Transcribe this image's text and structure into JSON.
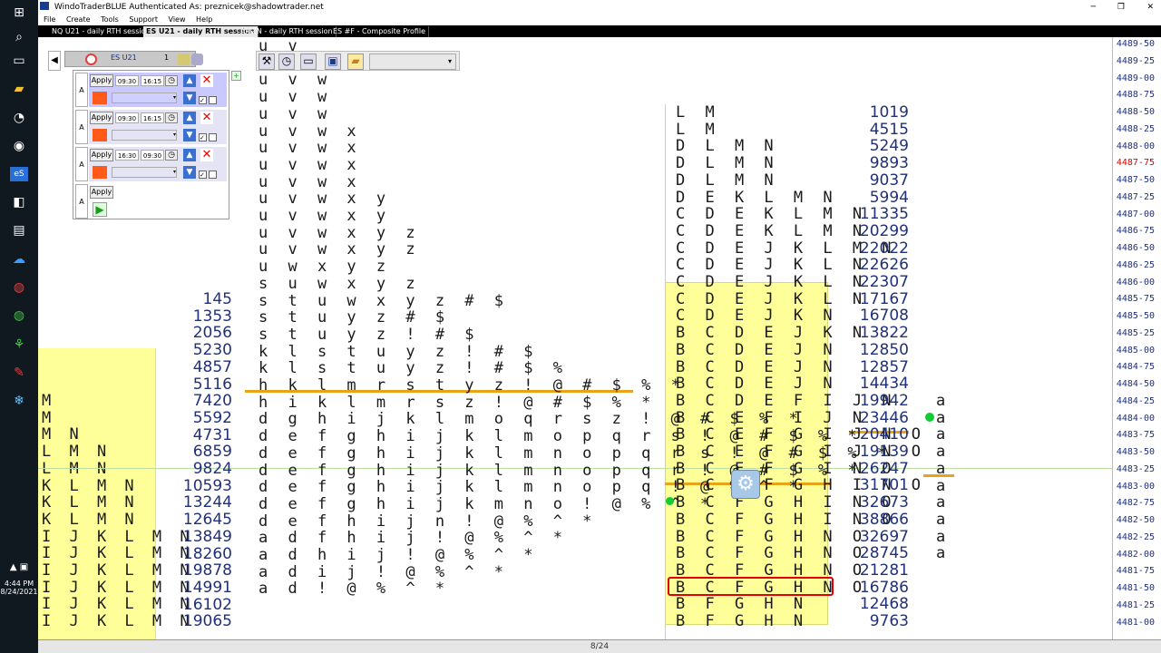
{
  "app_title": "WindoTraderBLUE  Authenticated As: preznicek@shadowtrader.net",
  "menu": [
    "File",
    "Create",
    "Tools",
    "Support",
    "View",
    "Help"
  ],
  "tabs": [
    "NQ U21 - daily RTH session",
    "ES U21 - daily RTH session",
    "AMZN - daily RTH session",
    "ES #F - Composite Profile"
  ],
  "toolbar": {
    "symbol": "ES U21",
    "count": "1"
  },
  "panel": {
    "rows": [
      {
        "side": "A",
        "apply": "Apply",
        "start": "09:30",
        "end": "16:15"
      },
      {
        "side": "A",
        "apply": "Apply",
        "start": "09:30",
        "end": "16:15"
      },
      {
        "side": "A",
        "apply": "Apply",
        "start": "16:30",
        "end": "09:30"
      },
      {
        "side": "A",
        "apply": "Apply"
      }
    ]
  },
  "tray": {
    "time": "4:44 PM",
    "date": "8/24/2021"
  },
  "status": "8/24",
  "prices": [
    "4489-50",
    "4489-25",
    "4489-00",
    "4488-75",
    "4488-50",
    "4488-25",
    "4488-00",
    "4487-75",
    "4487-50",
    "4487-25",
    "4487-00",
    "4486-75",
    "4486-50",
    "4486-25",
    "4486-00",
    "4485-75",
    "4485-50",
    "4485-25",
    "4485-00",
    "4484-75",
    "4484-50",
    "4484-25",
    "4484-00",
    "4483-75",
    "4483-50",
    "4483-25",
    "4483-00",
    "4482-75",
    "4482-50",
    "4482-25",
    "4482-00",
    "4481-75",
    "4481-50",
    "4481-25",
    "4481-00"
  ],
  "highlight_price": "4487-75",
  "overnight_profile": [
    "u v",
    "u v",
    "u v w",
    "u v w",
    "u v w",
    "u v w x",
    "u v w x",
    "u v w x",
    "u v w x",
    "u v w x y",
    "u v w x y",
    "u v w x y z",
    "u v w x y z",
    "u w x y z",
    "s u w x y z",
    "s t u w x y z # $",
    "s t u y z # $",
    "s t u y z ! # $",
    "k l s t u y z ! # $",
    "k l s t u y z ! # $ %",
    "h k l m r s t y z ! @ # $ % *",
    "h i k l m r s z ! @ # $ % *",
    "d g h i j k l m o q r s z ! @ # $ % *",
    "d e f g h i j k l m o p q r s ! @ # $ % *",
    "d e f g h i j k l m n o p q r s ! @ # $ % *",
    "d e f g h i j k l m n o p q r ! @ # $ % *",
    "d e f g h i j k l m n o p q ! @ % ^ *",
    "d e f g h i j k m n o ! @ % ^ *",
    "d e f h i j n ! @ % ^ *",
    "a d f h i j ! @ % ^ *",
    "a d h i j ! @ % ^ *",
    "a d i j ! @ % ^ *",
    "a d ! @ % ^ *"
  ],
  "overnight_volumes": [
    "145",
    "1353",
    "2056",
    "5230",
    "4857",
    "5116",
    "7420",
    "5592",
    "4731",
    "6859",
    "9824",
    "10593",
    "13244",
    "12645",
    "13849",
    "18260",
    "19878",
    "14991",
    "16102",
    "19065"
  ],
  "rth_profile": [
    "L M",
    "L M",
    "D L M N",
    "D L M N",
    "D L M N",
    "D E K L M N",
    "C D E K L M N",
    "C D E K L M N",
    "C D E J K L M N",
    "C D E J K L N",
    "C D E J K L N",
    "C D E J K L N",
    "C D E J K N",
    "B C D E J K N",
    "B C D E J N",
    "B C D E J N",
    "B C D E J N",
    "B C D E F I J N",
    "B C E F I J N",
    "B C E F G I J N O",
    "B C E F G I J N O",
    "B C E F G I N O",
    "B C E F G H I N O",
    "B C F G H I N O",
    "B C F G H I N O",
    "B C F G H N O",
    "B C F G H N O",
    "B C F G H N O",
    "B C F G H N O",
    "B F G H N",
    "B F G H N"
  ],
  "rth_volumes": [
    "1019",
    "4515",
    "5249",
    "9893",
    "9037",
    "5994",
    "11335",
    "20299",
    "22022",
    "22626",
    "22307",
    "17167",
    "16708",
    "13822",
    "12850",
    "12857",
    "14434",
    "19942",
    "23446",
    "20410",
    "19139",
    "26247",
    "31701",
    "32673",
    "38866",
    "32697",
    "28745",
    "21281",
    "16786",
    "12468",
    "9763"
  ],
  "today_letters": [
    "a",
    "a",
    "a",
    "a",
    "a",
    "a",
    "a",
    "a",
    "a",
    "a"
  ],
  "left_profile": [
    "M",
    "M",
    "M N",
    "L M N",
    "L M N",
    "K L M N",
    "K L M N",
    "K L M N",
    "I J K L M N",
    "I J K L M N",
    "I J K L M N",
    "I J K L M N",
    "I J K L M N",
    "I J K L M N"
  ],
  "colors": {
    "value_area": "#ffff99",
    "orange_line": "#e8a317",
    "red_box": "#e00000",
    "green_dot": "#11cc33"
  }
}
